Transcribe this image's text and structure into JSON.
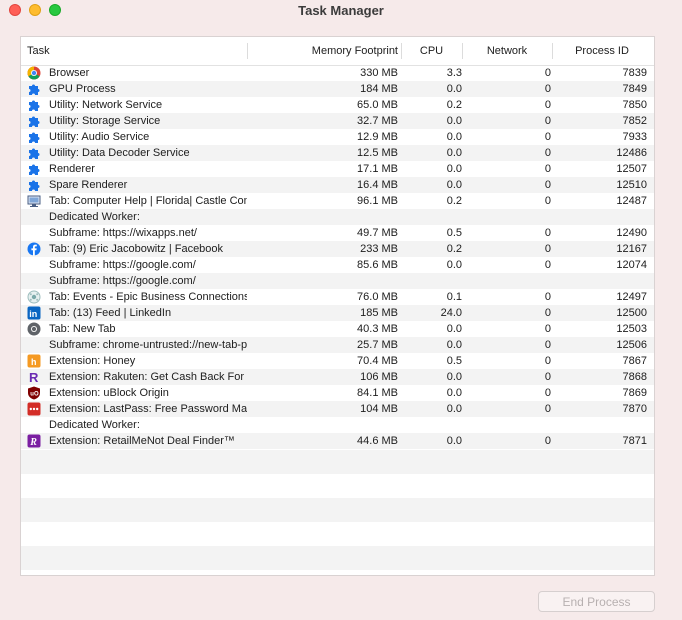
{
  "window": {
    "title": "Task Manager"
  },
  "columns": {
    "task": "Task",
    "memory": "Memory Footprint",
    "cpu": "CPU",
    "network": "Network",
    "pid": "Process ID"
  },
  "rows": [
    {
      "icon": "chrome-icon",
      "task": "Browser",
      "memory": "330 MB",
      "cpu": "3.3",
      "network": "0",
      "pid": "7839"
    },
    {
      "icon": "puzzle-icon",
      "task": "GPU Process",
      "memory": "184 MB",
      "cpu": "0.0",
      "network": "0",
      "pid": "7849"
    },
    {
      "icon": "puzzle-icon",
      "task": "Utility: Network Service",
      "memory": "65.0 MB",
      "cpu": "0.2",
      "network": "0",
      "pid": "7850"
    },
    {
      "icon": "puzzle-icon",
      "task": "Utility: Storage Service",
      "memory": "32.7 MB",
      "cpu": "0.0",
      "network": "0",
      "pid": "7852"
    },
    {
      "icon": "puzzle-icon",
      "task": "Utility: Audio Service",
      "memory": "12.9 MB",
      "cpu": "0.0",
      "network": "0",
      "pid": "7933"
    },
    {
      "icon": "puzzle-icon",
      "task": "Utility: Data Decoder Service",
      "memory": "12.5 MB",
      "cpu": "0.0",
      "network": "0",
      "pid": "12486"
    },
    {
      "icon": "puzzle-icon",
      "task": "Renderer",
      "memory": "17.1 MB",
      "cpu": "0.0",
      "network": "0",
      "pid": "12507"
    },
    {
      "icon": "puzzle-icon",
      "task": "Spare Renderer",
      "memory": "16.4 MB",
      "cpu": "0.0",
      "network": "0",
      "pid": "12510"
    },
    {
      "icon": "computer-icon",
      "task": "Tab: Computer Help | Florida| Castle Computer",
      "memory": "96.1 MB",
      "cpu": "0.2",
      "network": "0",
      "pid": "12487"
    },
    {
      "icon": "",
      "task": "Dedicated Worker:",
      "memory": "",
      "cpu": "",
      "network": "",
      "pid": ""
    },
    {
      "icon": "",
      "task": "Subframe: https://wixapps.net/",
      "memory": "49.7 MB",
      "cpu": "0.5",
      "network": "0",
      "pid": "12490"
    },
    {
      "icon": "facebook-icon",
      "task": "Tab: (9) Eric Jacobowitz | Facebook",
      "memory": "233 MB",
      "cpu": "0.2",
      "network": "0",
      "pid": "12167"
    },
    {
      "icon": "",
      "task": "Subframe: https://google.com/",
      "memory": "85.6 MB",
      "cpu": "0.0",
      "network": "0",
      "pid": "12074"
    },
    {
      "icon": "",
      "task": "Subframe: https://google.com/",
      "memory": "",
      "cpu": "",
      "network": "",
      "pid": ""
    },
    {
      "icon": "events-icon",
      "task": "Tab: Events - Epic Business Connections",
      "memory": "76.0 MB",
      "cpu": "0.1",
      "network": "0",
      "pid": "12497"
    },
    {
      "icon": "linkedin-icon",
      "task": "Tab: (13) Feed | LinkedIn",
      "memory": "185 MB",
      "cpu": "24.0",
      "network": "0",
      "pid": "12500"
    },
    {
      "icon": "new-tab-icon",
      "task": "Tab: New Tab",
      "memory": "40.3 MB",
      "cpu": "0.0",
      "network": "0",
      "pid": "12503"
    },
    {
      "icon": "",
      "task": "Subframe: chrome-untrusted://new-tab-page/",
      "memory": "25.7 MB",
      "cpu": "0.0",
      "network": "0",
      "pid": "12506"
    },
    {
      "icon": "honey-icon",
      "task": "Extension: Honey",
      "memory": "70.4 MB",
      "cpu": "0.5",
      "network": "0",
      "pid": "7867"
    },
    {
      "icon": "rakuten-icon",
      "task": "Extension: Rakuten: Get Cash Back For Shopping",
      "memory": "106 MB",
      "cpu": "0.0",
      "network": "0",
      "pid": "7868"
    },
    {
      "icon": "ublock-icon",
      "task": "Extension: uBlock Origin",
      "memory": "84.1 MB",
      "cpu": "0.0",
      "network": "0",
      "pid": "7869"
    },
    {
      "icon": "lastpass-icon",
      "task": "Extension: LastPass: Free Password Manager",
      "memory": "104 MB",
      "cpu": "0.0",
      "network": "0",
      "pid": "7870"
    },
    {
      "icon": "",
      "task": "Dedicated Worker:",
      "memory": "",
      "cpu": "",
      "network": "",
      "pid": ""
    },
    {
      "icon": "retailmenot-icon",
      "task": "Extension: RetailMeNot Deal Finder™",
      "memory": "44.6 MB",
      "cpu": "0.0",
      "network": "0",
      "pid": "7871"
    }
  ],
  "footer": {
    "end_process": "End Process"
  }
}
